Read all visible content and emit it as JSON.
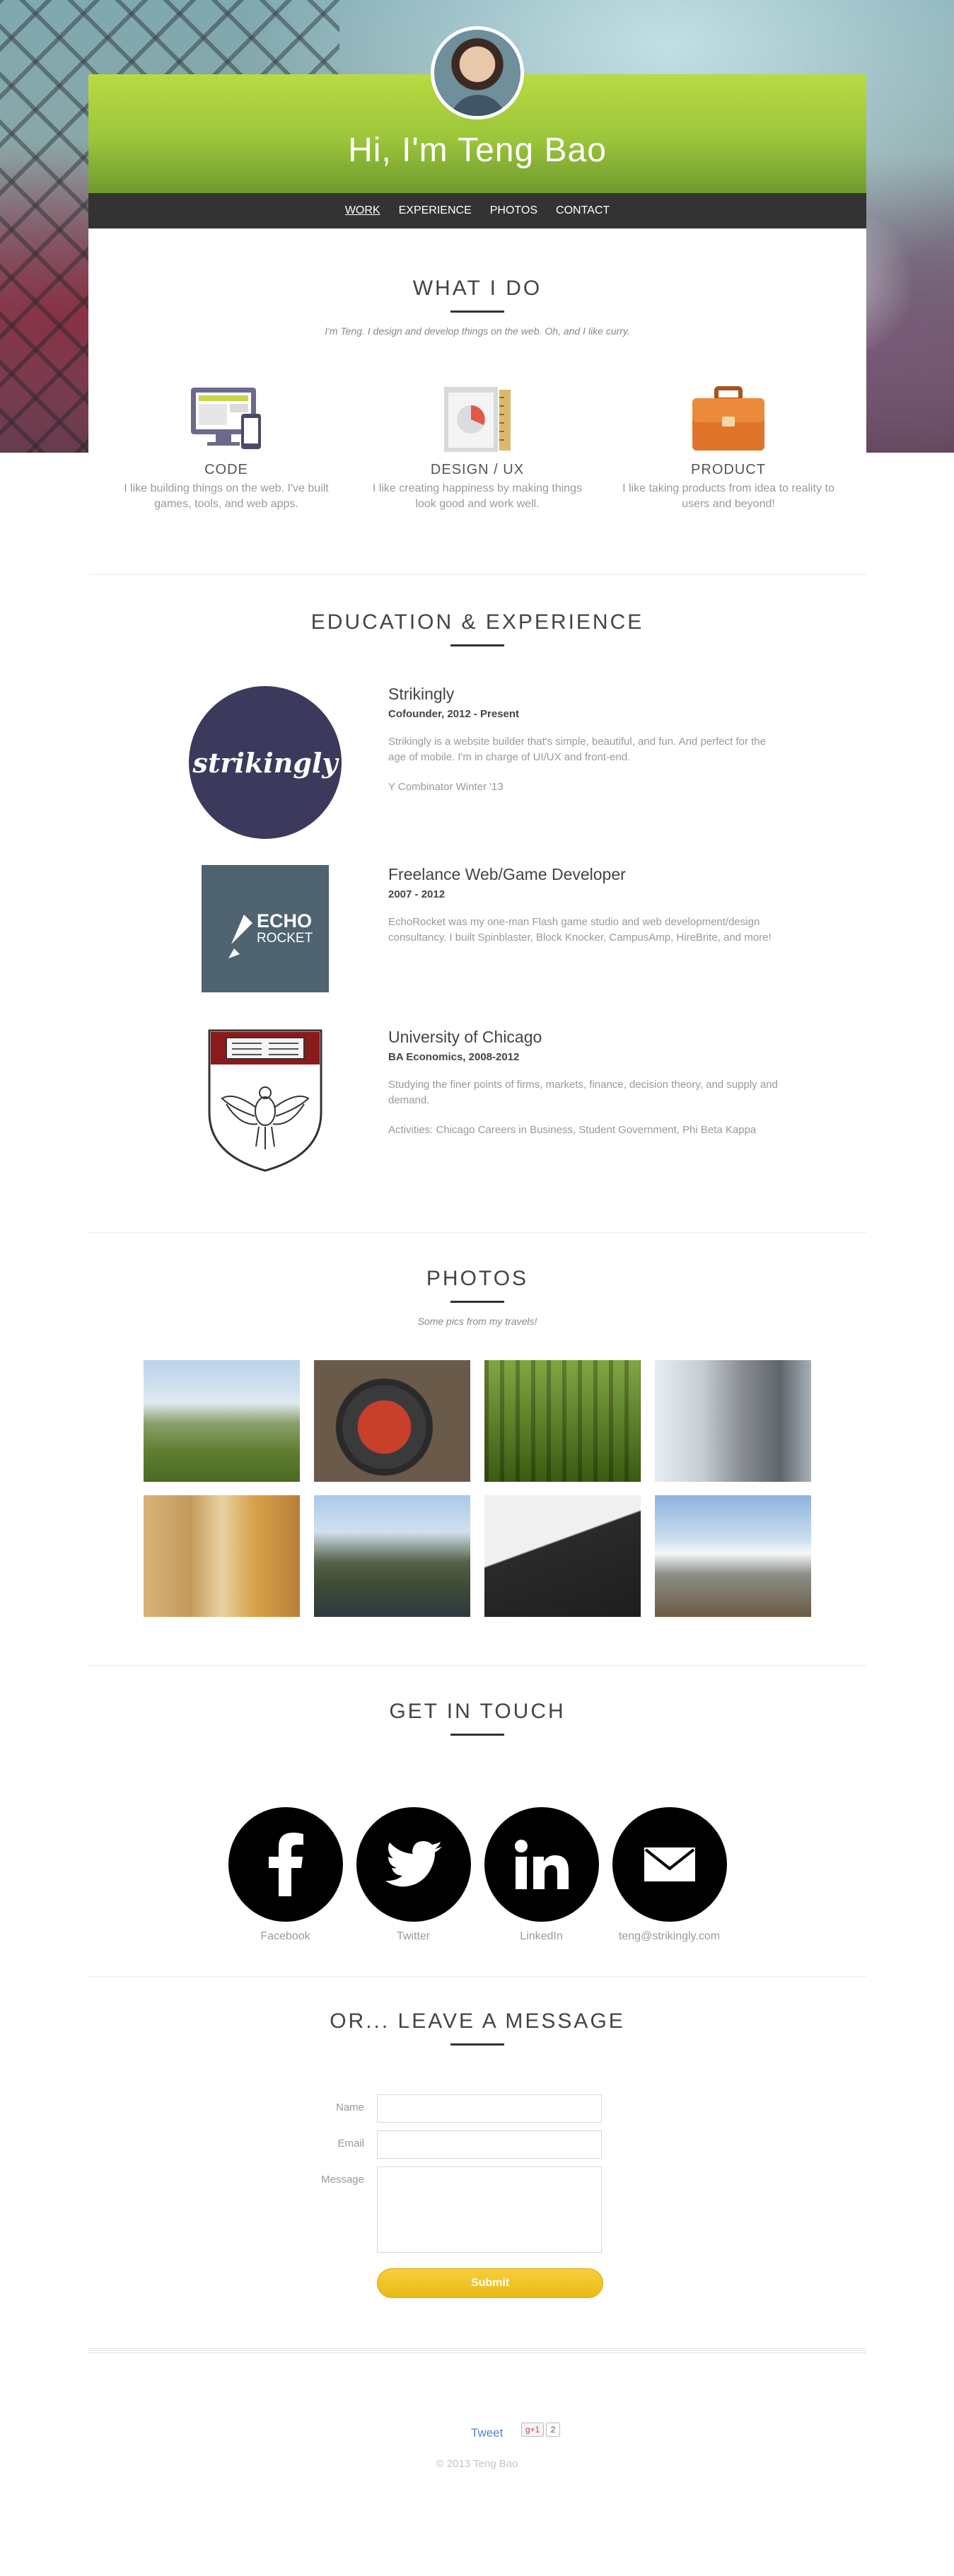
{
  "hero": {
    "title": "Hi, I'm Teng Bao"
  },
  "nav": {
    "items": [
      "WORK",
      "EXPERIENCE",
      "PHOTOS",
      "CONTACT"
    ]
  },
  "what_i_do": {
    "title": "WHAT I DO",
    "subtitle": "I'm Teng. I design and develop things on the web. Oh, and I like curry.",
    "features": [
      {
        "icon": "monitor-icon",
        "title": "CODE",
        "desc": "I like building things on the web. I've built games, tools, and web apps."
      },
      {
        "icon": "design-chart-icon",
        "title": "DESIGN / UX",
        "desc": "I like creating happiness by making things look good and work well."
      },
      {
        "icon": "briefcase-icon",
        "title": "PRODUCT",
        "desc": "I like taking products from idea to reality to users and beyond!"
      }
    ]
  },
  "education": {
    "title": "EDUCATION & EXPERIENCE",
    "items": [
      {
        "logo": "strikingly",
        "title": "Strikingly",
        "dates": "Cofounder, 2012 - Present",
        "desc": "Strikingly is a website builder that's simple, beautiful, and fun. And perfect for the age of mobile. I'm in charge of UI/UX and front-end.",
        "extra": "Y Combinator Winter '13"
      },
      {
        "logo_line1": "ECHO",
        "logo_line2": "ROCKET",
        "title": "Freelance Web/Game Developer",
        "dates": "2007 - 2012",
        "desc": "EchoRocket was my one-man Flash game studio and web development/design consultancy. I built Spinblaster, Block Knocker, CampusAmp, HireBrite, and more!",
        "extra": ""
      },
      {
        "title": "University of Chicago",
        "dates": "BA Economics, 2008-2012",
        "desc": "Studying the finer points of firms, markets, finance, decision theory, and supply and demand.",
        "extra": "Activities: Chicago Careers in Business, Student Government, Phi Beta Kappa"
      }
    ]
  },
  "photos": {
    "title": "PHOTOS",
    "subtitle": "Some pics from my travels!"
  },
  "contact": {
    "title": "GET IN TOUCH",
    "socials": [
      {
        "icon": "facebook-icon",
        "label": "Facebook"
      },
      {
        "icon": "twitter-icon",
        "label": "Twitter"
      },
      {
        "icon": "linkedin-icon",
        "label": "LinkedIn"
      },
      {
        "icon": "email-icon",
        "label": "teng@strikingly.com"
      }
    ]
  },
  "message": {
    "title": "OR... LEAVE A MESSAGE",
    "name_label": "Name",
    "email_label": "Email",
    "message_label": "Message",
    "submit_label": "Submit"
  },
  "footer": {
    "tweet_label": "Tweet",
    "gplus_label": "g+1",
    "gplus_count": "2",
    "copyright": "© 2013 Teng Bao"
  },
  "colors": {
    "nav_bg": "#333333",
    "hero_green": "#9bc53a",
    "submit": "#f0c22a",
    "strikingly": "#3b3a5c",
    "echorocket": "#4f6470",
    "uchicago": "#8b1a1a"
  }
}
